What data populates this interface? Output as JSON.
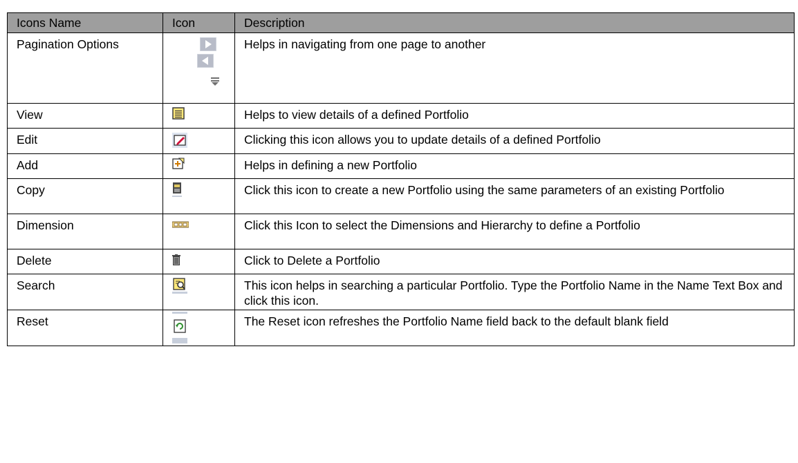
{
  "table": {
    "headers": {
      "name": "Icons Name",
      "icon": "Icon",
      "description": "Description"
    },
    "rows": [
      {
        "name": "Pagination Options",
        "icons": [
          "next-page-icon",
          "previous-page-icon",
          "rows-per-page-icon"
        ],
        "description": "Helps in navigating from one page to another"
      },
      {
        "name": "View",
        "icons": [
          "view-icon"
        ],
        "description": "Helps to view details of a defined Portfolio"
      },
      {
        "name": "Edit",
        "icons": [
          "edit-icon"
        ],
        "description": "Clicking this icon allows you to update details of a defined Portfolio"
      },
      {
        "name": "Add",
        "icons": [
          "add-icon"
        ],
        "description": "Helps in defining a new Portfolio"
      },
      {
        "name": "Copy",
        "icons": [
          "copy-icon"
        ],
        "description": "Click this icon to create a new Portfolio using the same parameters of an existing Portfolio"
      },
      {
        "name": "Dimension",
        "icons": [
          "dimension-icon"
        ],
        "description": "Click this Icon to select the Dimensions and Hierarchy to define a Portfolio"
      },
      {
        "name": "Delete",
        "icons": [
          "delete-icon"
        ],
        "description": "Click to Delete a Portfolio"
      },
      {
        "name": "Search",
        "icons": [
          "search-icon"
        ],
        "description": "This icon helps in searching a particular Portfolio. Type the Portfolio Name in the Name Text Box and click this icon."
      },
      {
        "name": "Reset",
        "icons": [
          "reset-icon"
        ],
        "description": "The Reset icon refreshes the Portfolio Name field back to the default blank field"
      }
    ]
  },
  "colors": {
    "header_background": "#9e9e9e",
    "border": "#000000",
    "pager_icon": "#b8bcc8",
    "view_icon_fill": "#ffe97a",
    "edit_icon_accent": "#d0103a",
    "reset_icon_accent": "#2f8f2f"
  }
}
